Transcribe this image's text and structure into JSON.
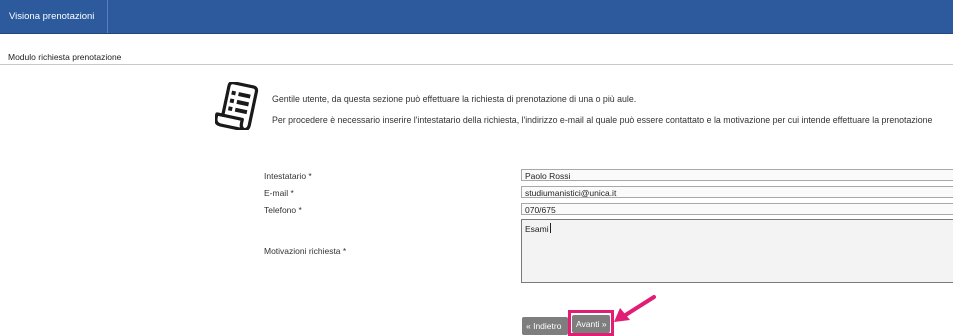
{
  "topbar": {
    "tab_label": "Visiona prenotazioni"
  },
  "section": {
    "title": "Modulo richiesta prenotazione"
  },
  "intro": {
    "line1": "Gentile utente, da questa sezione può effettuare la richiesta di prenotazione di una o più aule.",
    "line2": "Per procedere è necessario inserire l'intestatario della richiesta, l'indirizzo e-mail al quale può essere contattato e la motivazione per cui intende effettuare la prenotazione"
  },
  "form": {
    "intestatario_label": "Intestatario *",
    "intestatario_value": "Paolo Rossi",
    "email_label": "E-mail *",
    "email_value": "studiumanistici@unica.it",
    "telefono_label": "Telefono *",
    "telefono_value": "070/675",
    "motivazioni_label": "Motivazioni richiesta *",
    "motivazioni_value": "Esami"
  },
  "buttons": {
    "back_label": "« Indietro",
    "next_label": "Avanti »"
  },
  "colors": {
    "topbar": "#2c5a9c",
    "highlight": "#e11d74",
    "button": "#7e7e7e"
  },
  "icons": {
    "intro_icon": "document-list-icon",
    "annotation": "pink-arrow-icon"
  }
}
